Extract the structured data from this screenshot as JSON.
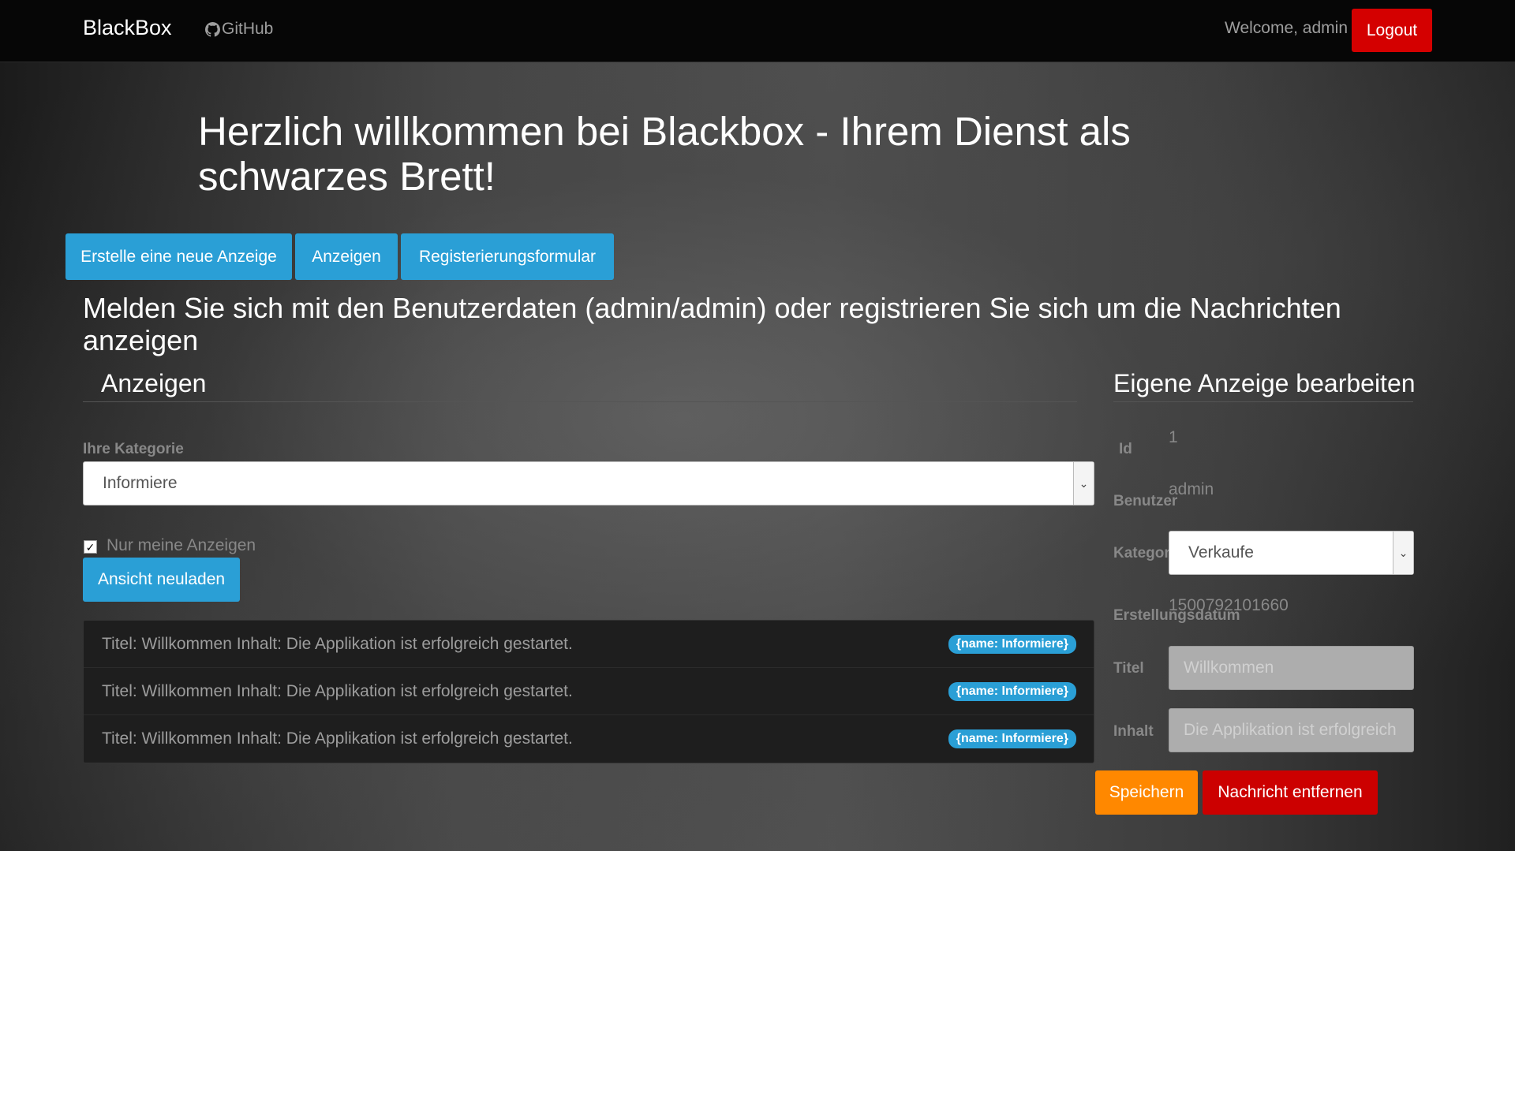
{
  "navbar": {
    "brand": "BlackBox",
    "github_label": "GitHub",
    "welcome": "Welcome, admin",
    "logout_label": "Logout"
  },
  "hero": {
    "title": "Herzlich willkommen bei Blackbox - Ihrem Dienst als schwarzes Brett!",
    "tabs": [
      {
        "label": "Erstelle eine neue Anzeige"
      },
      {
        "label": "Anzeigen"
      },
      {
        "label": "Registerierungsformular"
      }
    ],
    "login_hint": "Melden Sie sich mit den Benutzerdaten (admin/admin) oder registrieren Sie sich um die Nachrichten anzeigen"
  },
  "ads": {
    "title": "Anzeigen",
    "category_label": "Ihre Kategorie",
    "category_value": "Informiere",
    "only_mine_label": "Nur meine Anzeigen",
    "only_mine_checked": true,
    "reload_label": "Ansicht neuladen",
    "items": [
      {
        "text": "Titel: Willkommen Inhalt: Die Applikation ist erfolgreich gestartet.",
        "badge": "{name: Informiere}"
      },
      {
        "text": "Titel: Willkommen Inhalt: Die Applikation ist erfolgreich gestartet.",
        "badge": "{name: Informiere}"
      },
      {
        "text": "Titel: Willkommen Inhalt: Die Applikation ist erfolgreich gestartet.",
        "badge": "{name: Informiere}"
      }
    ]
  },
  "edit": {
    "title": "Eigene Anzeige bearbeiten",
    "id_label": "Id",
    "id_value": "1",
    "user_label": "Benutzer",
    "user_value": "admin",
    "category_label": "Kategorie",
    "category_value": "Verkaufe",
    "created_label": "Erstellungsdatum",
    "created_value": "1500792101660",
    "title_label": "Titel",
    "title_value": "Willkommen",
    "content_label": "Inhalt",
    "content_value": "Die Applikation ist erfolgreich",
    "save_label": "Speichern",
    "delete_label": "Nachricht entfernen"
  },
  "colors": {
    "accent": "#2a9fd6",
    "danger": "#cc0000",
    "warning": "#ff8800",
    "navbar": "#060606"
  }
}
